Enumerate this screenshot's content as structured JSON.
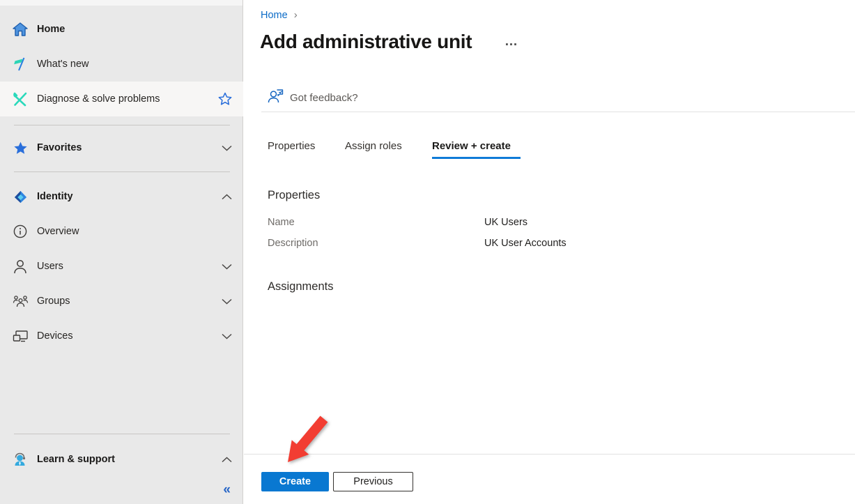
{
  "sidebar": {
    "items": [
      {
        "label": "Home"
      },
      {
        "label": "What's new"
      },
      {
        "label": "Diagnose & solve problems"
      },
      {
        "label": "Favorites"
      },
      {
        "label": "Identity"
      },
      {
        "label": "Overview"
      },
      {
        "label": "Users"
      },
      {
        "label": "Groups"
      },
      {
        "label": "Devices"
      },
      {
        "label": "Learn & support"
      }
    ],
    "collapse_label": "«"
  },
  "header": {
    "breadcrumb": "Home",
    "breadcrumb_separator": "›",
    "title": "Add administrative unit",
    "more_label": "…",
    "feedback_label": "Got feedback?"
  },
  "tabs": {
    "items": [
      {
        "label": "Properties"
      },
      {
        "label": "Assign roles"
      },
      {
        "label": "Review + create"
      }
    ],
    "active": "Review + create"
  },
  "content": {
    "properties_heading": "Properties",
    "fields": [
      {
        "label": "Name",
        "value": "UK Users"
      },
      {
        "label": "Description",
        "value": "UK User Accounts"
      }
    ],
    "assignments_heading": "Assignments"
  },
  "footer": {
    "create_label": "Create",
    "previous_label": "Previous"
  },
  "colors": {
    "accent": "#0078d4",
    "active_tab_underline": "#0f7bd7",
    "sidebar_bg": "#e9e9e9",
    "arrow_red": "#f23d32"
  }
}
